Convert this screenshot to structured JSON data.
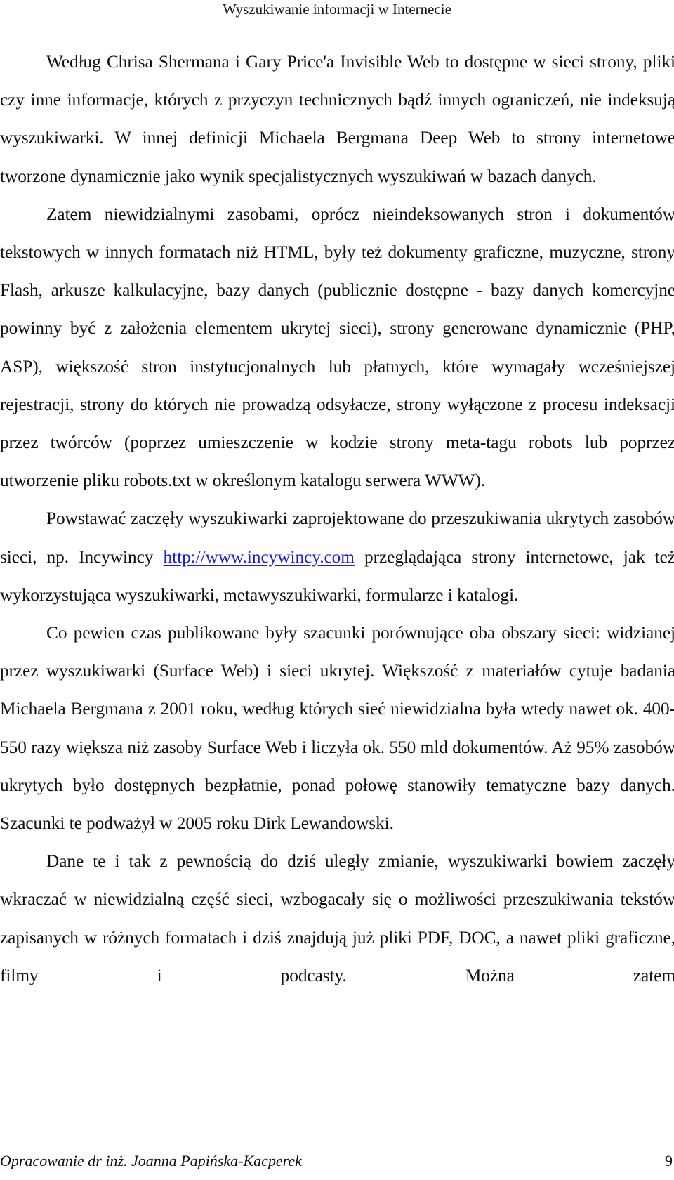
{
  "header": {
    "title": "Wyszukiwanie informacji w Internecie"
  },
  "paragraphs": [
    {
      "text": "Według Chrisa Shermana i Gary Price'a Invisible Web to dostępne w sieci strony, pliki czy inne informacje, których z przyczyn technicznych bądź innych ograniczeń, nie indeksują wyszukiwarki. W innej definicji Michaela Bergmana Deep Web to strony internetowe tworzone dynamicznie jako wynik specjalistycznych wyszukiwań w bazach danych."
    },
    {
      "text": "Zatem niewidzialnymi zasobami, oprócz nieindeksowanych stron i dokumentów tekstowych w innych formatach niż HTML, były też dokumenty graficzne, muzyczne, strony Flash, arkusze kalkulacyjne, bazy danych (publicznie dostępne - bazy danych komercyjne powinny być z założenia elementem ukrytej sieci), strony generowane dynamicznie (PHP, ASP), większość stron instytucjonalnych lub płatnych, które wymagały wcześniejszej rejestracji, strony do których nie prowadzą odsyłacze, strony wyłączone z procesu indeksacji przez twórców (poprzez umieszczenie w kodzie strony meta-tagu robots lub poprzez utworzenie pliku robots.txt w określonym katalogu serwera WWW)."
    },
    {
      "before_link": "Powstawać zaczęły wyszukiwarki zaprojektowane do przeszukiwania ukrytych zasobów sieci, np. Incywincy ",
      "link_text": "http://www.incywincy.com",
      "after_link": " przeglądająca strony internetowe, jak też wykorzystująca wyszukiwarki, metawyszukiwarki, formularze i katalogi."
    },
    {
      "text": "Co pewien czas publikowane były szacunki porównujące oba obszary sieci: widzianej przez wyszukiwarki (Surface Web) i sieci ukrytej. Większość z materiałów cytuje badania Michaela Bergmana z 2001 roku, według których sieć niewidzialna była wtedy nawet ok. 400-550 razy większa niż zasoby Surface Web i liczyła ok. 550 mld dokumentów. Aż 95% zasobów ukrytych było dostępnych bezpłatnie, ponad połowę stanowiły tematyczne bazy danych. Szacunki te podważył w 2005 roku Dirk Lewandowski."
    },
    {
      "text": "Dane te i tak z pewnością do dziś uległy zmianie, wyszukiwarki bowiem zaczęły wkraczać w niewidzialną część sieci, wzbogacały się o możliwości przeszukiwania tekstów zapisanych w różnych formatach i dziś znajdują już pliki PDF, DOC, a nawet pliki graficzne, filmy i podcasty. Można zatem"
    }
  ],
  "colors": {
    "link": "#1f1fd6",
    "text": "#111111"
  },
  "footer": {
    "author": "Opracowanie dr inż. Joanna Papińska-Kacperek",
    "page_number": "9"
  }
}
